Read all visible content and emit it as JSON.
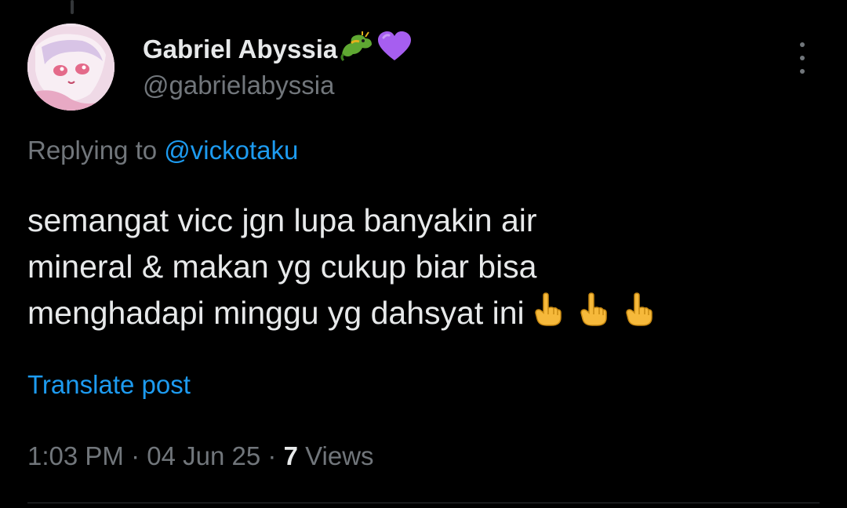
{
  "author": {
    "name": "Gabriel Abyssia",
    "name_emojis": [
      "dragon-emoji",
      "purple-heart-emoji"
    ],
    "handle": "@gabrielabyssia"
  },
  "reply": {
    "prefix": "Replying to",
    "mention": "@vickotaku"
  },
  "tweet": {
    "lines": [
      "semangat vicc jgn lupa banyakin air",
      "mineral & makan yg cukup biar bisa",
      "menghadapi minggu yg dahsyat ini"
    ],
    "trailing_emojis": [
      "index-pointing-up-emoji",
      "index-pointing-up-emoji",
      "index-pointing-up-emoji"
    ]
  },
  "translate_label": "Translate post",
  "meta": {
    "time": "1:03 PM",
    "date": "04 Jun 25",
    "sep": "·",
    "views_count": "7",
    "views_label": "Views"
  },
  "colors": {
    "background": "#000000",
    "primary_text": "#e7e9ea",
    "secondary_text": "#71767b",
    "link": "#1d9bf0",
    "divider": "#2f3336"
  }
}
